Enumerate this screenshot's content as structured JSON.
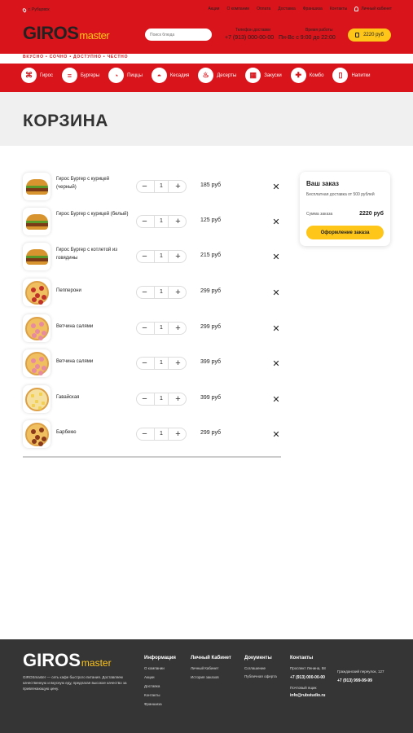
{
  "header": {
    "city": "г. Рубцовск",
    "nav": [
      "Акции",
      "О компании",
      "Оплата",
      "Доставка",
      "Франшиза"
    ],
    "contacts": "Контакты",
    "account": "Личный кабинет",
    "logo_main": "GIROS",
    "logo_sub": "master",
    "search_placeholder": "Поиск блюда",
    "phone_label": "Телефон доставки",
    "phone": "+7 (913) 000-00-00",
    "hours_label": "Время работы",
    "hours": "Пн-Вс с 9:00 до 22:00",
    "cart_total": "2220 руб",
    "tagline": "ВКУСНО • СОЧНО • ДОСТУПНО • ЧЕСТНО"
  },
  "categories": [
    {
      "label": "Гирос",
      "icon": "gyros-icon",
      "glyph": "⌘"
    },
    {
      "label": "Бургеры",
      "icon": "burger-icon",
      "glyph": "≡"
    },
    {
      "label": "Пиццы",
      "icon": "pizza-icon",
      "glyph": "◔"
    },
    {
      "label": "Кесадия",
      "icon": "quesadilla-icon",
      "glyph": "◓"
    },
    {
      "label": "Десерты",
      "icon": "dessert-icon",
      "glyph": "♨"
    },
    {
      "label": "Закуски",
      "icon": "snack-icon",
      "glyph": "▦"
    },
    {
      "label": "Комбо",
      "icon": "combo-icon",
      "glyph": "✚"
    },
    {
      "label": "Напитки",
      "icon": "drink-icon",
      "glyph": "▯"
    }
  ],
  "page_title": "КОРЗИНА",
  "cart_items": [
    {
      "name": "Гирос Бургер с курицей (черный)",
      "qty": "1",
      "price": "185 руб",
      "img": "burger"
    },
    {
      "name": "Гирос Бургер с курицей (белый)",
      "qty": "1",
      "price": "125 руб",
      "img": "burger"
    },
    {
      "name": "Гирос Бургер с котлетой из говядины",
      "qty": "1",
      "price": "215 руб",
      "img": "burger"
    },
    {
      "name": "Пепперони",
      "qty": "1",
      "price": "299 руб",
      "img": "pep"
    },
    {
      "name": "Ветчина салями",
      "qty": "1",
      "price": "299 руб",
      "img": "ham"
    },
    {
      "name": "Ветчина салями",
      "qty": "1",
      "price": "399 руб",
      "img": "ham"
    },
    {
      "name": "Гавайская",
      "qty": "1",
      "price": "399 руб",
      "img": "haw"
    },
    {
      "name": "Барбекю",
      "qty": "1",
      "price": "299 руб",
      "img": "bbq"
    }
  ],
  "order": {
    "title": "Ваш заказ",
    "free_delivery": "Бесплатная доставка от 500 рублей",
    "sum_label": "Сумма заказа",
    "sum_value": "2220 руб",
    "button": "Оформление заказа"
  },
  "footer": {
    "logo_main": "GIROS",
    "logo_sub": "master",
    "description": "GIROSmaster — сеть кафе быстрого питания. Доставляем качественную и вкусную еду, предлагая высокое качество за привлекающую цену.",
    "info_title": "Информация",
    "info_links": [
      "О компании",
      "Акции",
      "Доставка",
      "Контакты",
      "Франшиза"
    ],
    "cabinet_title": "Личный Кабинет",
    "cabinet_links": [
      "Личный Кабинет",
      "История заказов"
    ],
    "docs_title": "Документы",
    "docs_links": [
      "Соглашение",
      "Публичная оферта"
    ],
    "contacts_title": "Контакты",
    "address1": "Проспект Ленина, 58",
    "phone1": "+7 (913) 000-00-00",
    "email_label": "Почтовый ящик",
    "email": "info@rubstudio.ru",
    "address2": "Гражданский переулок, 127",
    "phone2": "+7 (913) 999-99-99"
  }
}
